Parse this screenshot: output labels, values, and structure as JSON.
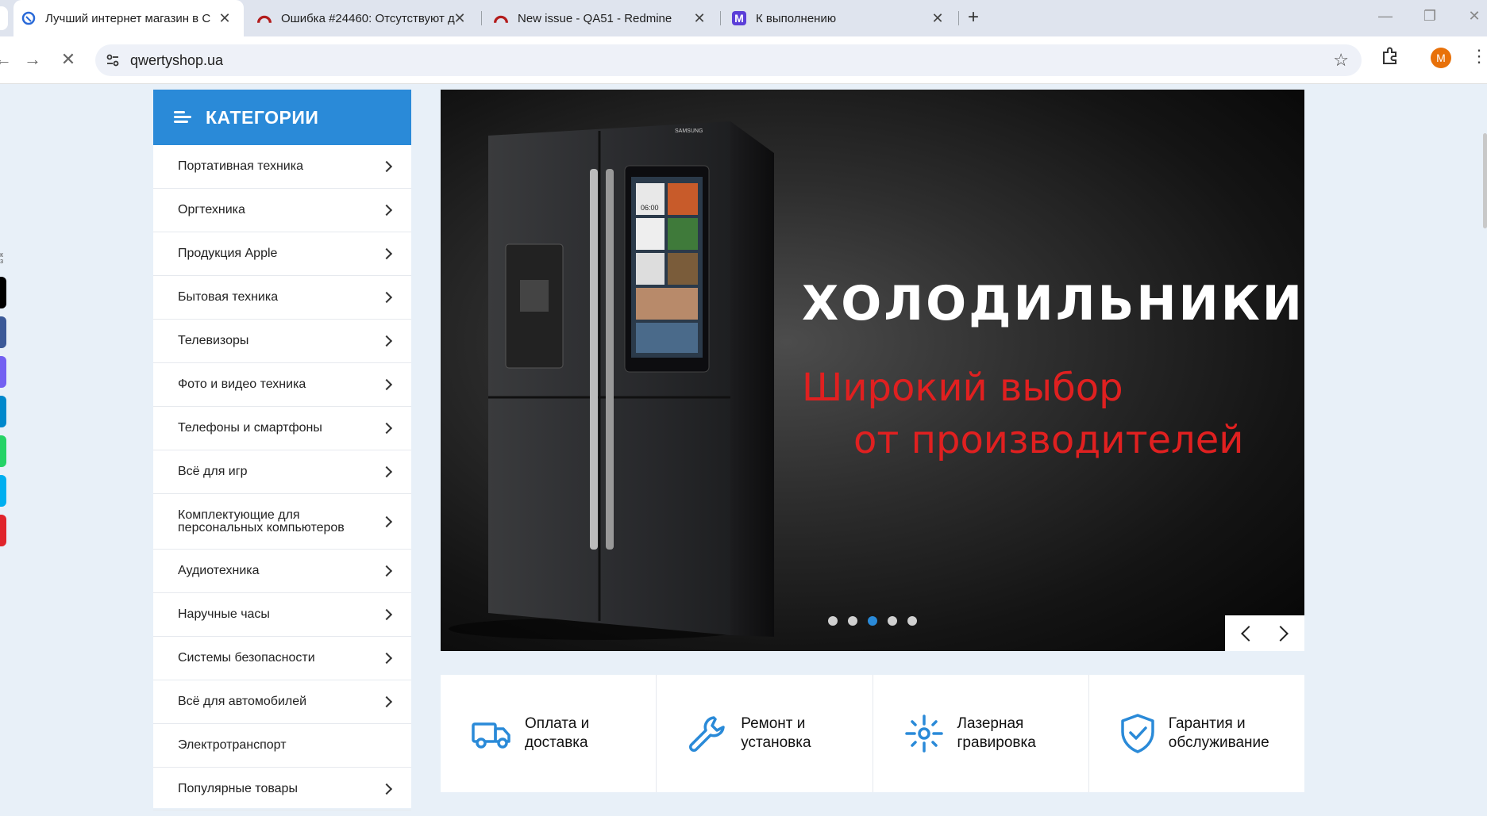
{
  "browser": {
    "tabs": [
      {
        "title": "Лучший интернет магазин в С",
        "active": true
      },
      {
        "title": "Ошибка #24460: Отсутствуют д",
        "active": false
      },
      {
        "title": "New issue - QA51 - Redmine",
        "active": false
      },
      {
        "title": "К выполнению",
        "active": false
      }
    ],
    "url": "qwertyshop.ua",
    "profile_initial": "M",
    "favicon_letter": "M"
  },
  "social_colors": [
    "#000000",
    "#3b5998",
    "#7360f2",
    "#0088cc",
    "#25d366",
    "#00aff0",
    "#e0242c"
  ],
  "sidebar": {
    "header": "КАТЕГОРИИ",
    "items": [
      {
        "label": "Портативная техника",
        "arrow": true
      },
      {
        "label": "Оргтехника",
        "arrow": true
      },
      {
        "label": "Продукция Apple",
        "arrow": true
      },
      {
        "label": "Бытовая техника",
        "arrow": true
      },
      {
        "label": "Телевизоры",
        "arrow": true
      },
      {
        "label": "Фото и видео техника",
        "arrow": true
      },
      {
        "label": "Телефоны и смартфоны",
        "arrow": true
      },
      {
        "label": "Всё для игр",
        "arrow": true
      },
      {
        "label": "Комплектующие для персональных компьютеров",
        "arrow": true
      },
      {
        "label": "Аудиотехника",
        "arrow": true
      },
      {
        "label": "Наручные часы",
        "arrow": true
      },
      {
        "label": "Системы безопасности",
        "arrow": true
      },
      {
        "label": "Всё для автомобилей",
        "arrow": true
      },
      {
        "label": "Электротранспорт",
        "arrow": false
      },
      {
        "label": "Популярные товары",
        "arrow": true
      }
    ]
  },
  "banner": {
    "title": "ХОЛОДИЛЬНИКИ",
    "subtitle_line1": "Широкий выбор",
    "subtitle_line2": "от производителей",
    "brand": "SAMSUNG",
    "screen_time": "06:00",
    "slide_count": 5,
    "active_slide": 3
  },
  "features": [
    {
      "icon": "truck-icon",
      "line1": "Оплата и",
      "line2": "доставка"
    },
    {
      "icon": "wrench-icon",
      "line1": "Ремонт и",
      "line2": "установка"
    },
    {
      "icon": "laser-icon",
      "line1": "Лазерная",
      "line2": "гравировка"
    },
    {
      "icon": "shield-check-icon",
      "line1": "Гарантия и",
      "line2": "обслуживание"
    }
  ],
  "colors": {
    "accent": "#2a8ad8",
    "banner_red": "#e02020"
  }
}
